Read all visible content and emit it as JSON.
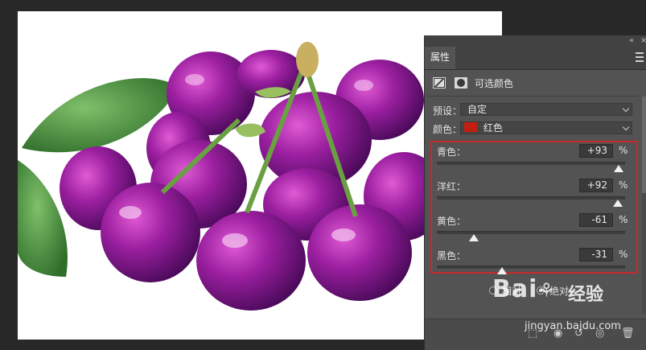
{
  "canvas": {
    "image": "purple-cherries",
    "background": "#ffffff"
  },
  "panel": {
    "tab_label": "属性",
    "adjustment_name": "可选颜色",
    "preset_label": "预设：",
    "preset_value": "自定",
    "colors_label": "颜色：",
    "colors_value": "红色",
    "colors_swatch": "#c21f10",
    "sliders": [
      {
        "label": "青色：",
        "value": "+93",
        "unit": "%",
        "level": 0.965
      },
      {
        "label": "洋红：",
        "value": "+92",
        "unit": "%",
        "level": 0.96
      },
      {
        "label": "黄色：",
        "value": "-61",
        "unit": "%",
        "level": 0.195
      },
      {
        "label": "黑色：",
        "value": "-31",
        "unit": "%",
        "level": 0.345
      }
    ],
    "highlight_color": "#c9292b",
    "method_relative": "相对",
    "method_absolute": "绝对",
    "method_selected": "absolute"
  },
  "watermark": {
    "brand": "Bai",
    "brand_suffix": "经验",
    "url": "jingyan.baidu.com"
  }
}
